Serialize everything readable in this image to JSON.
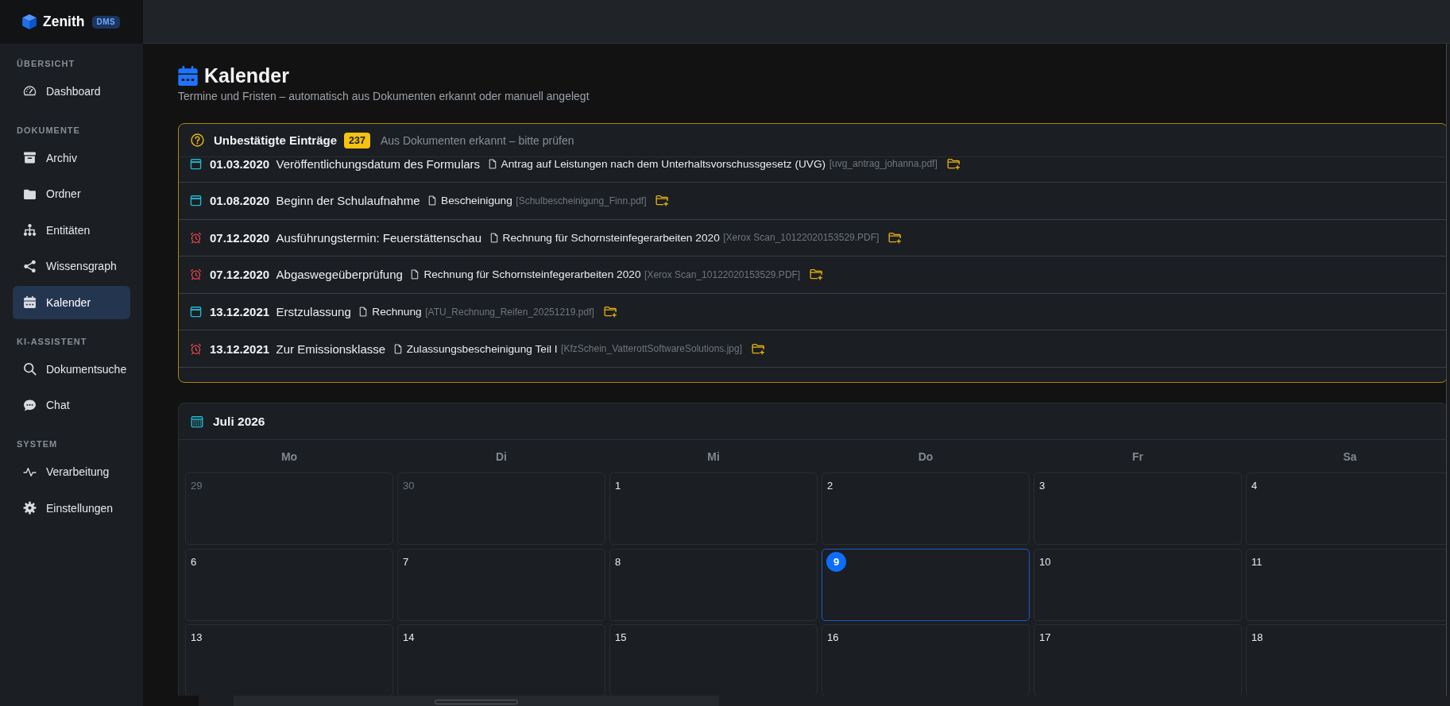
{
  "sidebar": {
    "brand": {
      "name": "Zenith",
      "badge": "DMS"
    },
    "sections": [
      {
        "label": "ÜBERSICHT",
        "items": [
          {
            "label": "Dashboard",
            "selected": false
          }
        ]
      },
      {
        "label": "DOKUMENTE",
        "items": [
          {
            "label": "Archiv",
            "selected": false
          },
          {
            "label": "Ordner",
            "selected": false
          },
          {
            "label": "Entitäten",
            "selected": false
          },
          {
            "label": "Wissensgraph",
            "selected": false
          },
          {
            "label": "Kalender",
            "selected": true
          }
        ]
      },
      {
        "label": "KI-ASSISTENT",
        "items": [
          {
            "label": "Dokumentsuche",
            "selected": false
          },
          {
            "label": "Chat",
            "selected": false
          }
        ]
      },
      {
        "label": "SYSTEM",
        "items": [
          {
            "label": "Verarbeitung",
            "selected": false
          },
          {
            "label": "Einstellungen",
            "selected": false
          }
        ]
      }
    ]
  },
  "page": {
    "title": "Kalender",
    "subtitle": "Termine und Fristen – automatisch aus Dokumenten erkannt oder manuell angelegt"
  },
  "unconfirmed": {
    "title": "Unbestätigte Einträge",
    "count": "237",
    "hint": "Aus Dokumenten erkannt – bitte prüfen",
    "entries": [
      {
        "kind": "event",
        "date": "01.03.2020",
        "title": "Veröffentlichungsdatum des Formulars",
        "document": "Antrag auf Leistungen nach dem Unterhaltsvorschussgesetz (UVG)",
        "file": "[uvg_antrag_johanna.pdf]"
      },
      {
        "kind": "event",
        "date": "01.08.2020",
        "title": "Beginn der Schulaufnahme",
        "document": "Bescheinigung",
        "file": "[Schulbescheinigung_Finn.pdf]"
      },
      {
        "kind": "deadline",
        "date": "07.12.2020",
        "title": "Ausführungstermin: Feuerstättenschau",
        "document": "Rechnung für Schornsteinfegerarbeiten 2020",
        "file": "[Xerox Scan_10122020153529.PDF]"
      },
      {
        "kind": "deadline",
        "date": "07.12.2020",
        "title": "Abgaswegeüberprüfung",
        "document": "Rechnung für Schornsteinfegerarbeiten 2020",
        "file": "[Xerox Scan_10122020153529.PDF]"
      },
      {
        "kind": "event",
        "date": "13.12.2021",
        "title": "Erstzulassung",
        "document": "Rechnung",
        "file": "[ATU_Rechnung_Reifen_20251219.pdf]"
      },
      {
        "kind": "deadline",
        "date": "13.12.2021",
        "title": "Zur Emissionsklasse",
        "document": "Zulassungsbescheinigung Teil I",
        "file": "[KfzSchein_VatterottSoftwareSolutions.jpg]"
      }
    ]
  },
  "calendar": {
    "title": "Juli 2026",
    "weekdays": [
      "Mo",
      "Di",
      "Mi",
      "Do",
      "Fr",
      "Sa"
    ],
    "weeks": [
      {
        "days": [
          {
            "day": "29",
            "in_month": false,
            "today": false
          },
          {
            "day": "30",
            "in_month": false,
            "today": false
          },
          {
            "day": "1",
            "in_month": true,
            "today": false
          },
          {
            "day": "2",
            "in_month": true,
            "today": false
          },
          {
            "day": "3",
            "in_month": true,
            "today": false
          },
          {
            "day": "4",
            "in_month": true,
            "today": false
          }
        ]
      },
      {
        "days": [
          {
            "day": "6",
            "in_month": true,
            "today": false
          },
          {
            "day": "7",
            "in_month": true,
            "today": false
          },
          {
            "day": "8",
            "in_month": true,
            "today": false
          },
          {
            "day": "9",
            "in_month": true,
            "today": true
          },
          {
            "day": "10",
            "in_month": true,
            "today": false
          },
          {
            "day": "11",
            "in_month": true,
            "today": false
          }
        ]
      },
      {
        "days": [
          {
            "day": "13",
            "in_month": true,
            "today": false
          },
          {
            "day": "14",
            "in_month": true,
            "today": false
          },
          {
            "day": "15",
            "in_month": true,
            "today": false
          },
          {
            "day": "16",
            "in_month": true,
            "today": false
          },
          {
            "day": "17",
            "in_month": true,
            "today": false
          },
          {
            "day": "18",
            "in_month": true,
            "today": false
          }
        ]
      }
    ]
  }
}
